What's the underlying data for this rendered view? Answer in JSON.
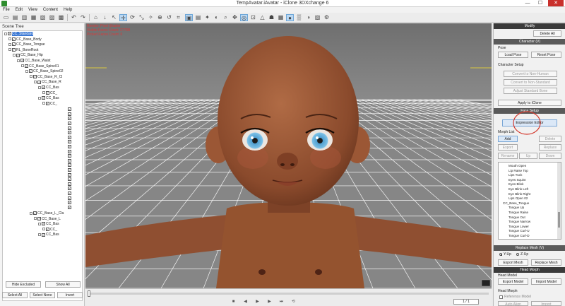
{
  "window": {
    "title": "TempAvatar.iAvatar - iClone 3DXchange 6",
    "minimize": "—",
    "maximize": "☐",
    "close": "✕"
  },
  "menu": [
    "File",
    "Edit",
    "View",
    "Content",
    "Help"
  ],
  "scene_tree": {
    "header": "Scene Tree",
    "nodes": [
      {
        "label": "CC_Standard",
        "indent": 0,
        "selected": true
      },
      {
        "label": "CC_Base_Body",
        "indent": 1
      },
      {
        "label": "CC_Base_Tongue",
        "indent": 1
      },
      {
        "label": "RL_BoneRoot",
        "indent": 1
      },
      {
        "label": "CC_Base_Hip",
        "indent": 2
      },
      {
        "label": "CC_Base_Waist",
        "indent": 3
      },
      {
        "label": "CC_Base_Spine01",
        "indent": 4
      },
      {
        "label": "CC_Base_Spine02",
        "indent": 5
      },
      {
        "label": "CC_Base_R_Cl",
        "indent": 6
      },
      {
        "label": "CC_Base_R",
        "indent": 7
      },
      {
        "label": "CC_Bas",
        "indent": 8
      },
      {
        "label": "CC_",
        "indent": 9
      },
      {
        "label": "CC_Bas",
        "indent": 8
      },
      {
        "label": "CC_",
        "indent": 9
      },
      {
        "label": "CC_Base_L_Cla",
        "indent": 6
      },
      {
        "label": "CC_Base_L",
        "indent": 7
      },
      {
        "label": "CC_Bas",
        "indent": 8
      },
      {
        "label": "CC_",
        "indent": 9
      },
      {
        "label": "CC_Bas",
        "indent": 8
      }
    ],
    "hide_excluded": "Hide Excluded",
    "show_all": "Show All",
    "select_all": "Select All",
    "select_none": "Select None",
    "invert": "Invert"
  },
  "viewport": {
    "render_mode": "Render: Pixel Shader",
    "visible_faces": "Visible Faces Count: 27708",
    "picked_faces": "Picked Faces Count: 0",
    "background": "#7b7b7b",
    "skin_color": "#8a4a2c",
    "eye_color": "#4f9ecf"
  },
  "timeline": {
    "frame": "1 / 1",
    "position": 0.0
  },
  "modify": {
    "header": "Modify",
    "delete_all": "Delete All",
    "character_section": "Character (V)",
    "pose_label": "Pose",
    "load_pose": "Load Pose",
    "reset_pose": "Reset Pose",
    "character_setup_label": "Character Setup",
    "convert_non_human": "Convert to Non-Human",
    "convert_non_standard": "Convert to Non-Standard",
    "adjust_standard_bone": "Adjust Standard Bone",
    "apply_to_iclone": "Apply to iClone",
    "face_setup_section": "Face Setup",
    "expression_editor": "Expression Editor",
    "morph_list_label": "Morph List",
    "add": "Add",
    "delete": "Delete",
    "export": "Export",
    "replace": "Replace",
    "rename": "Rename",
    "up": "Up",
    "down": "Down",
    "morph_items": [
      {
        "label": "Mouth Open",
        "level": 1
      },
      {
        "label": "Lip Raise Top",
        "level": 1
      },
      {
        "label": "Lips Tuck",
        "level": 1
      },
      {
        "label": "Eyes Squint",
        "level": 1
      },
      {
        "label": "Eyes Blink",
        "level": 1
      },
      {
        "label": "Eye Blink Left",
        "level": 1
      },
      {
        "label": "Eye Blink Right",
        "level": 1
      },
      {
        "label": "Lips Open 02",
        "level": 1
      },
      {
        "label": "CC_Base_Tongue",
        "level": 0
      },
      {
        "label": "Tongue Up",
        "level": 1
      },
      {
        "label": "Tongue Raise",
        "level": 1
      },
      {
        "label": "Tongue Out",
        "level": 1
      },
      {
        "label": "Tongue Narrow",
        "level": 1
      },
      {
        "label": "Tongue Lower",
        "level": 1
      },
      {
        "label": "Tongue Curl-U",
        "level": 1
      },
      {
        "label": "Tongue Curl-D",
        "level": 1
      }
    ],
    "replace_mesh_section": "Replace Mesh (V)",
    "y_up": "Y-Up",
    "z_up": "Z-Up",
    "export_mesh": "Export Mesh",
    "replace_mesh": "Replace Mesh",
    "head_morph_section": "Head Morph",
    "head_model_label": "Head Model",
    "export_model": "Export Model",
    "import_model": "Import Model",
    "head_morph_label": "Head Morph",
    "reference_model": "Reference Model",
    "auto_align": "Auto Align",
    "import": "Import"
  }
}
